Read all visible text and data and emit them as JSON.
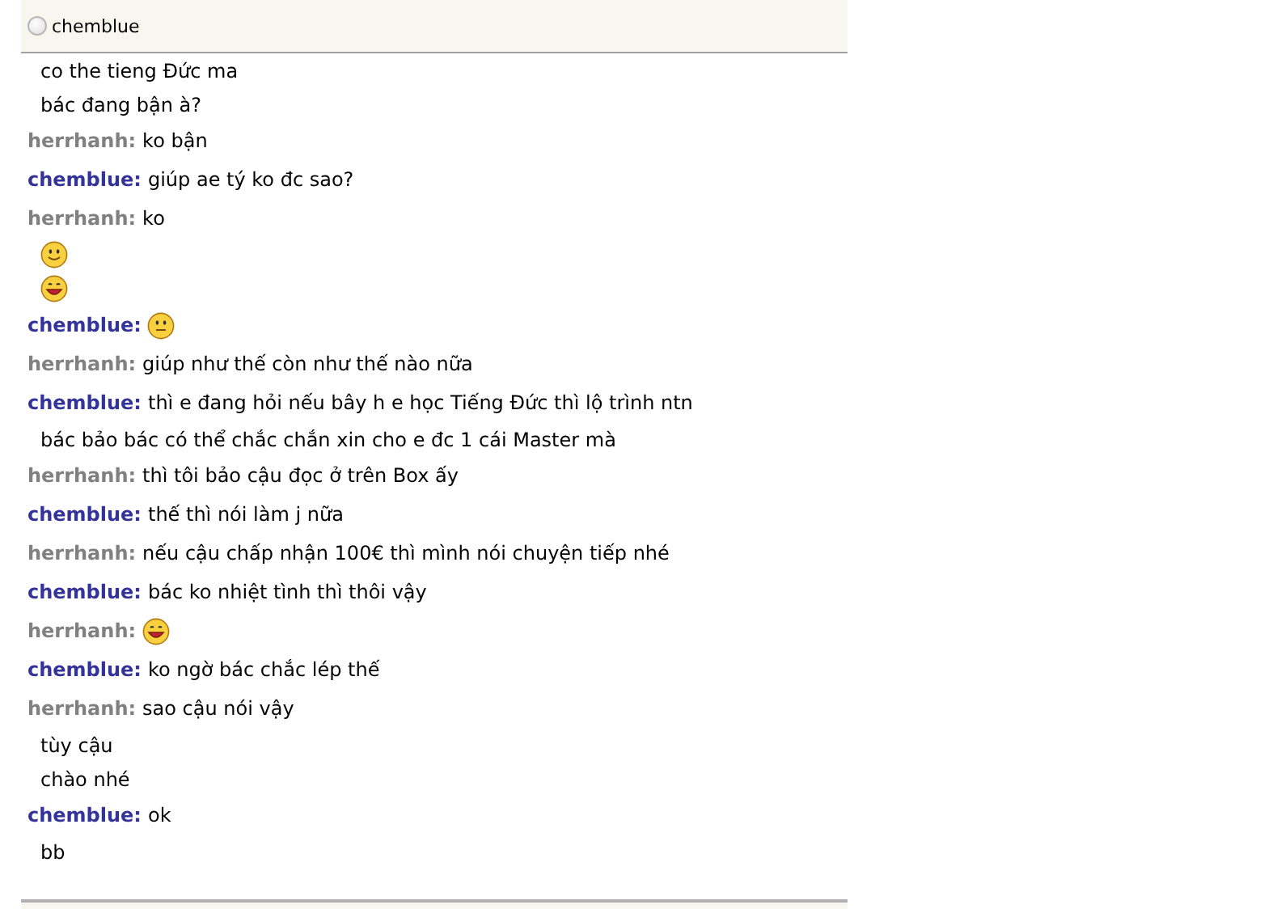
{
  "header": {
    "contact": "chemblue",
    "online": false
  },
  "messages": [
    {
      "kind": "text",
      "text": "co the tieng Đức ma"
    },
    {
      "kind": "text",
      "text": "bác đang bận à?"
    },
    {
      "kind": "text",
      "sender": "herrhanh:",
      "color": "#808080",
      "text": "ko bận"
    },
    {
      "kind": "text",
      "sender": "chemblue:",
      "color": "#333399",
      "text": "giúp ae tý ko đc sao?"
    },
    {
      "kind": "text",
      "sender": "herrhanh:",
      "color": "#808080",
      "text": "ko"
    },
    {
      "kind": "smile"
    },
    {
      "kind": "laugh"
    },
    {
      "kind": "straight",
      "sender": "chemblue:",
      "color": "#333399"
    },
    {
      "kind": "text",
      "sender": "herrhanh:",
      "color": "#808080",
      "text": "giúp như thế còn như thế nào nữa"
    },
    {
      "kind": "text",
      "sender": "chemblue:",
      "color": "#333399",
      "text": "thì e đang hỏi nếu bây h e học Tiếng Đức thì lộ trình ntn"
    },
    {
      "kind": "text",
      "text": "bác bảo bác có thể chắc chắn xin cho e đc 1 cái Master mà"
    },
    {
      "kind": "text",
      "sender": "herrhanh:",
      "color": "#808080",
      "text": "thì tôi bảo cậu đọc ở trên Box ấy"
    },
    {
      "kind": "text",
      "sender": "chemblue:",
      "color": "#333399",
      "text": "thế thì nói làm j nữa"
    },
    {
      "kind": "text",
      "sender": "herrhanh:",
      "color": "#808080",
      "text": "nếu cậu chấp nhận 100€ thì mình nói chuyện tiếp nhé"
    },
    {
      "kind": "text",
      "sender": "chemblue:",
      "color": "#333399",
      "text": "bác ko nhiệt tình thì thôi vậy"
    },
    {
      "kind": "laugh",
      "sender": "herrhanh:",
      "color": "#808080"
    },
    {
      "kind": "text",
      "sender": "chemblue:",
      "color": "#333399",
      "text": "ko ngờ bác chắc lép thế"
    },
    {
      "kind": "text",
      "sender": "herrhanh:",
      "color": "#808080",
      "text": "sao cậu nói vậy"
    },
    {
      "kind": "text",
      "text": "tùy cậu"
    },
    {
      "kind": "text",
      "text": "chào nhé"
    },
    {
      "kind": "text",
      "sender": "chemblue:",
      "color": "#333399",
      "text": "ok"
    },
    {
      "kind": "text",
      "text": "bb"
    }
  ]
}
